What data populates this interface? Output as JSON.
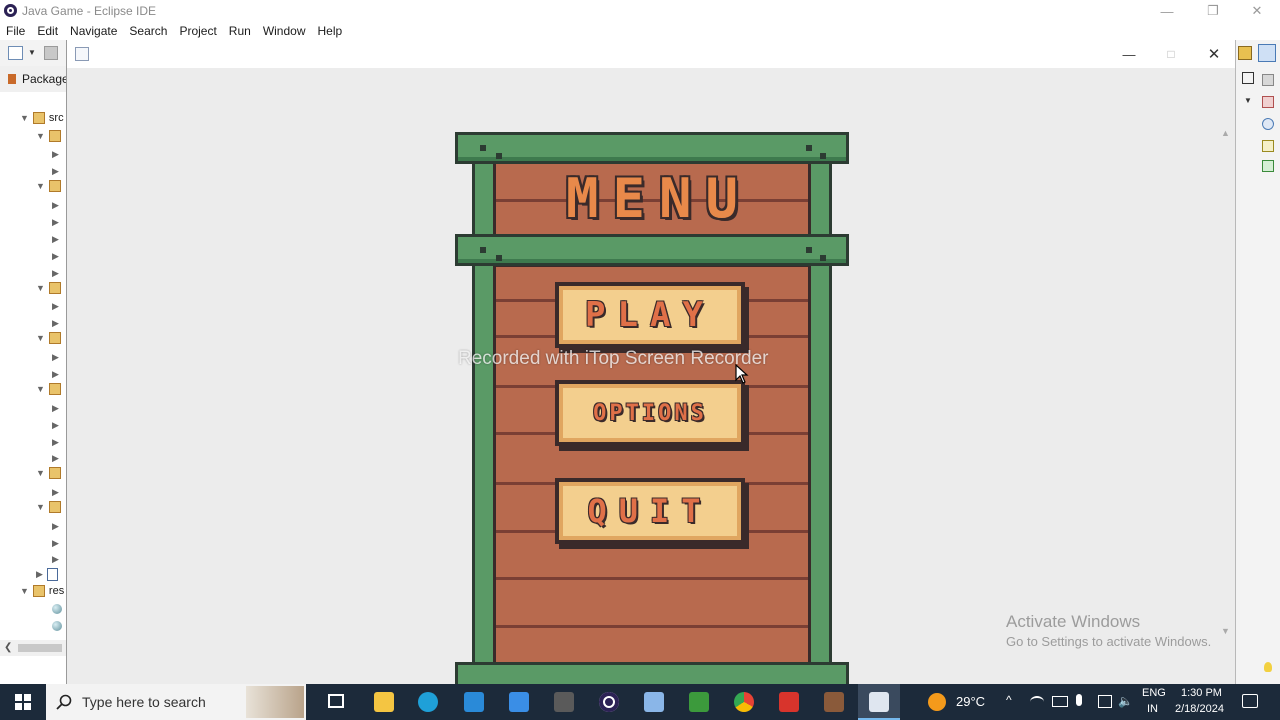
{
  "eclipse": {
    "title": "Java Game - Eclipse IDE",
    "menu": [
      "File",
      "Edit",
      "Navigate",
      "Search",
      "Project",
      "Run",
      "Window",
      "Help"
    ],
    "package_explorer_label": "Package",
    "tree": [
      {
        "label": "src"
      },
      {
        "label": "res"
      }
    ]
  },
  "game": {
    "title_text": "MENU",
    "buttons": [
      "PLAY",
      "OPTIONS",
      "QUIT"
    ]
  },
  "overlay": {
    "watermark": "Recorded with iTop Screen Recorder",
    "activate_title": "Activate Windows",
    "activate_sub": "Go to Settings to activate Windows."
  },
  "taskbar": {
    "search_placeholder": "Type here to search",
    "weather": "29°C",
    "lang_1": "ENG",
    "lang_2": "IN",
    "time": "1:30 PM",
    "date": "2/18/2024"
  }
}
